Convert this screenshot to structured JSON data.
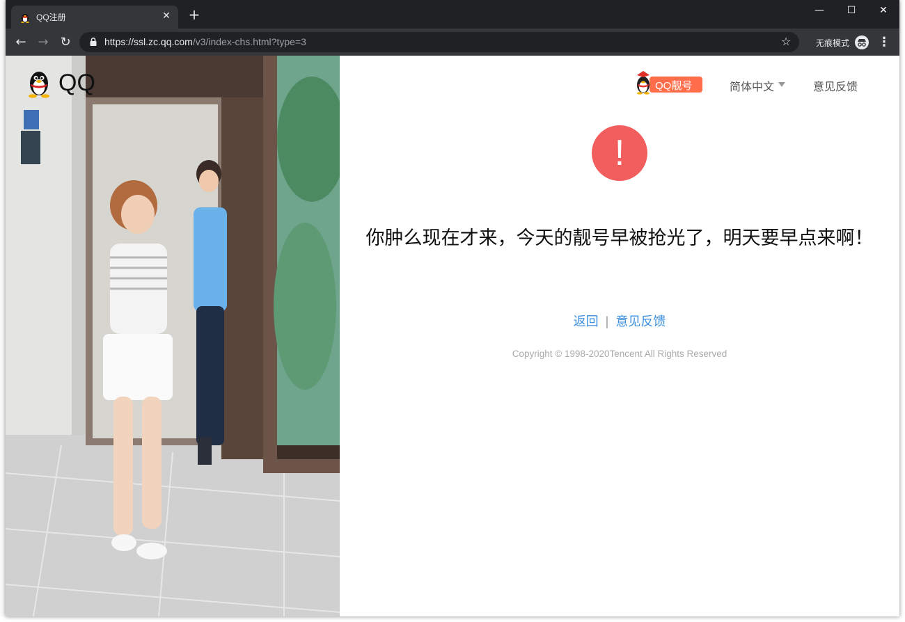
{
  "browser": {
    "tab_title": "QQ注册",
    "url_host": "https://ssl.zc.qq.com",
    "url_path": "/v3/index-chs.html?type=3",
    "incognito_label": "无痕模式"
  },
  "header": {
    "logo_text": "QQ",
    "lianghao_label": "QQ靓号",
    "language": "简体中文",
    "feedback": "意见反馈"
  },
  "main": {
    "alert_symbol": "!",
    "message": "你肿么现在才来，今天的靓号早被抢光了，明天要早点来啊！",
    "back_link": "返回",
    "separator": "|",
    "feedback_link": "意见反馈",
    "copyright": "Copyright © 1998-2020Tencent All Rights Reserved"
  },
  "colors": {
    "alert": "#f25d5d",
    "link": "#3b8fe0",
    "badge": "#ff6d4a"
  }
}
